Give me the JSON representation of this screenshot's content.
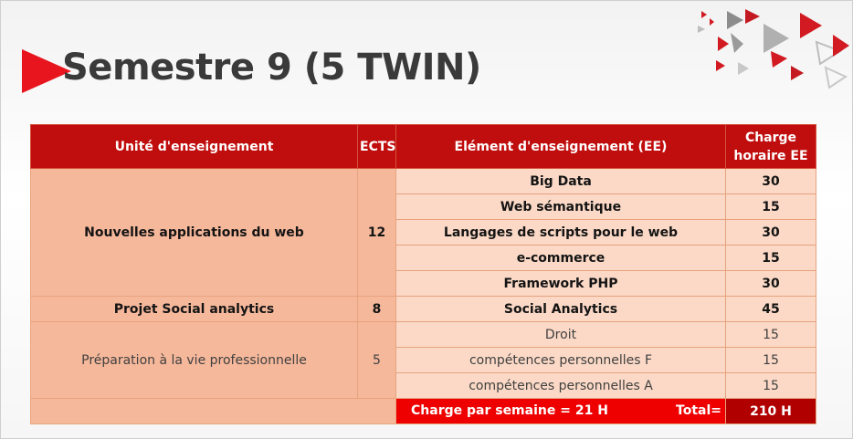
{
  "slide": {
    "title": "Semestre 9 (5 TWIN)"
  },
  "colors": {
    "header_red": "#c00d0d",
    "ue_fill": "#f6b89b",
    "ee_fill": "#fbd9c6",
    "footer_red": "#ee0000",
    "footer_dark": "#b00000"
  },
  "table": {
    "headers": {
      "ue": "Unité d'enseignement",
      "ects": "ECTS",
      "ee": "Elément d'enseignement (EE)",
      "charge_line1": "Charge",
      "charge_line2": "horaire EE"
    },
    "groups": [
      {
        "ue": "Nouvelles applications du web",
        "ects": "12",
        "rows": [
          {
            "ee": "Big  Data",
            "hours": "30"
          },
          {
            "ee": "Web sémantique",
            "hours": "15"
          },
          {
            "ee": "Langages de scripts pour le web",
            "hours": "30"
          },
          {
            "ee": "e-commerce",
            "hours": "15"
          },
          {
            "ee": "Framework PHP",
            "hours": "30"
          }
        ]
      },
      {
        "ue": "Projet Social analytics",
        "ects": "8",
        "rows": [
          {
            "ee": "Social Analytics",
            "hours": "45"
          }
        ]
      },
      {
        "ue": "Préparation à la vie professionnelle",
        "ects": "5",
        "rows": [
          {
            "ee": "Droit",
            "hours": "15"
          },
          {
            "ee": "compétences personnelles F",
            "hours": "15"
          },
          {
            "ee": "compétences personnelles A",
            "hours": "15"
          }
        ]
      }
    ],
    "footer": {
      "weekly_load": "Charge par semaine = 21 H",
      "total_label": "Total=",
      "total_value": "210 H"
    }
  }
}
